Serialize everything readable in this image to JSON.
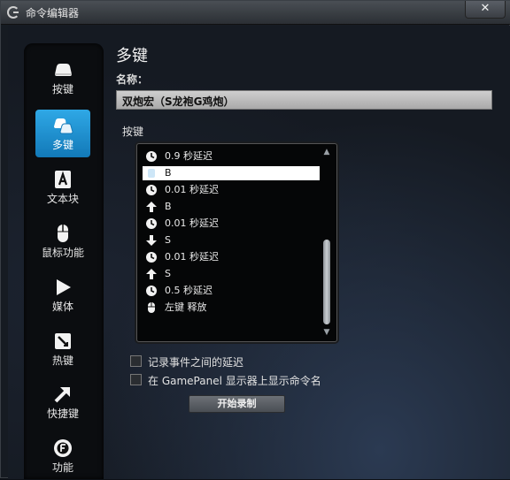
{
  "window": {
    "title": "命令编辑器",
    "close_label": "✕"
  },
  "sidebar": {
    "items": [
      {
        "label": "按键",
        "icon": "keycap-icon",
        "active": false
      },
      {
        "label": "多键",
        "icon": "multikey-icon",
        "active": true
      },
      {
        "label": "文本块",
        "icon": "text-block-icon",
        "active": false
      },
      {
        "label": "鼠标功能",
        "icon": "mouse-icon",
        "active": false
      },
      {
        "label": "媒体",
        "icon": "play-icon",
        "active": false
      },
      {
        "label": "热键",
        "icon": "hotkey-icon",
        "active": false
      },
      {
        "label": "快捷键",
        "icon": "shortcut-arrow-icon",
        "active": false
      },
      {
        "label": "功能",
        "icon": "function-gear-icon",
        "active": false
      }
    ]
  },
  "main": {
    "heading": "多键",
    "name_label": "名称：",
    "name_value": "双炮宏（S龙袍G鸡炮）",
    "keys_label": "按键",
    "key_list": [
      {
        "icon": "clock-icon",
        "text": "0.9 秒延迟",
        "selected": false
      },
      {
        "icon": "key-icon",
        "text": "B",
        "selected": true
      },
      {
        "icon": "clock-icon",
        "text": "0.01 秒延迟",
        "selected": false
      },
      {
        "icon": "arrow-up-icon",
        "text": "B",
        "selected": false
      },
      {
        "icon": "clock-icon",
        "text": "0.01 秒延迟",
        "selected": false
      },
      {
        "icon": "arrow-down-icon",
        "text": "S",
        "selected": false
      },
      {
        "icon": "clock-icon",
        "text": "0.01 秒延迟",
        "selected": false
      },
      {
        "icon": "arrow-up-icon",
        "text": "S",
        "selected": false
      },
      {
        "icon": "clock-icon",
        "text": "0.5 秒延迟",
        "selected": false
      },
      {
        "icon": "mouse-icon",
        "text": "左键 释放",
        "selected": false
      }
    ],
    "scroll_up": "▲",
    "scroll_down": "▼",
    "options": [
      {
        "label": "记录事件之间的延迟",
        "checked": false
      },
      {
        "label": "在 GamePanel 显示器上显示命令名",
        "checked": false
      }
    ],
    "record_button": "开始录制"
  },
  "colors": {
    "accent": "#1e90d6",
    "list_bg": "#050607",
    "selected_row": "#ffffff"
  }
}
